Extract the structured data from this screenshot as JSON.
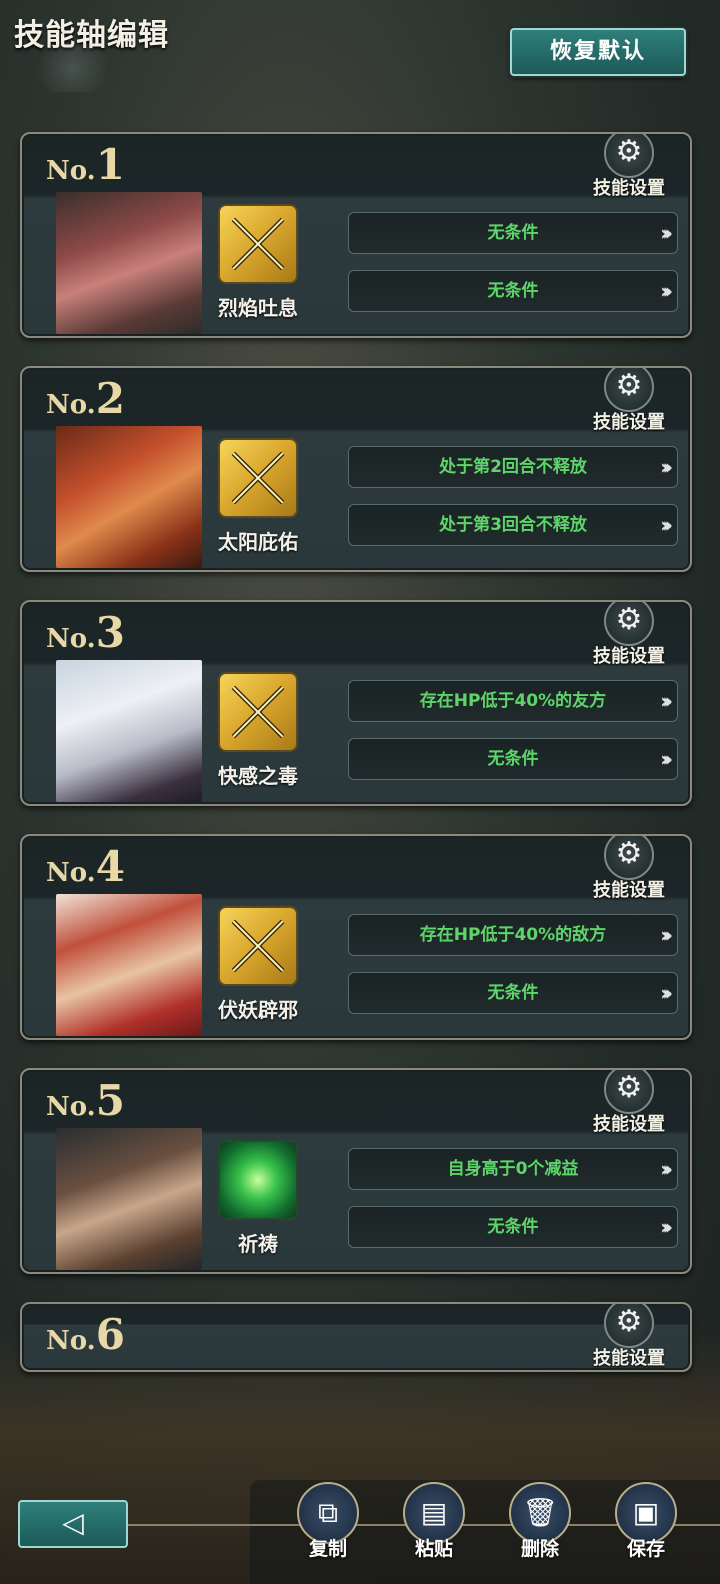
{
  "header": {
    "title": "技能轴编辑",
    "reset_label": "恢复默认"
  },
  "colors": {
    "condition_text": "#5ed56a",
    "accent_teal": "#2f7f7a",
    "card_border": "#8a8a7c"
  },
  "settings_label": "技能设置",
  "cards": [
    {
      "no_prefix": "No.",
      "number": "1",
      "skill": "烈焰吐息",
      "skill_icon": "crossed-swords-icon",
      "conditions": [
        "无条件",
        "无条件"
      ]
    },
    {
      "no_prefix": "No.",
      "number": "2",
      "skill": "太阳庇佑",
      "skill_icon": "crossed-swords-icon",
      "conditions": [
        "处于第2回合不释放",
        "处于第3回合不释放"
      ]
    },
    {
      "no_prefix": "No.",
      "number": "3",
      "skill": "快感之毒",
      "skill_icon": "crossed-swords-icon",
      "conditions": [
        "存在HP低于40%的友方",
        "无条件"
      ]
    },
    {
      "no_prefix": "No.",
      "number": "4",
      "skill": "伏妖辟邪",
      "skill_icon": "crossed-swords-icon",
      "conditions": [
        "存在HP低于40%的敌方",
        "无条件"
      ]
    },
    {
      "no_prefix": "No.",
      "number": "5",
      "skill": "祈祷",
      "skill_icon": "green-orb-icon",
      "conditions": [
        "自身高于0个减益",
        "无条件"
      ]
    },
    {
      "no_prefix": "No.",
      "number": "6"
    }
  ],
  "toolbar": {
    "copy": "复制",
    "paste": "粘贴",
    "delete": "删除",
    "save": "保存"
  },
  "icons": {
    "gear": "⚙",
    "chevrons": "»›",
    "back": "◁"
  }
}
